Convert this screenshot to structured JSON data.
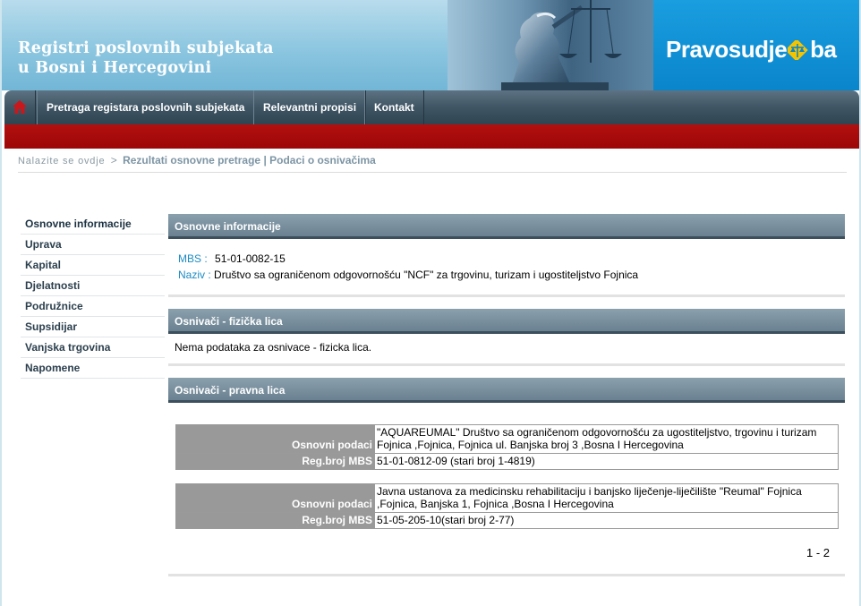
{
  "header": {
    "title_line1": "Registri poslovnih subjekata",
    "title_line2": "u Bosni i Hercegovini",
    "logo_left": "Pravosudje",
    "logo_right": "ba"
  },
  "nav": {
    "items": [
      {
        "label": "Pretraga registara poslovnih subjekata"
      },
      {
        "label": "Relevantni propisi"
      },
      {
        "label": "Kontakt"
      }
    ]
  },
  "breadcrumb": {
    "prefix": "Nalazite se ovdje",
    "separator": ">",
    "current": "Rezultati osnovne pretrage | Podaci o osnivačima"
  },
  "sidebar": {
    "items": [
      {
        "label": "Osnovne informacije"
      },
      {
        "label": "Uprava"
      },
      {
        "label": "Kapital"
      },
      {
        "label": "Djelatnosti"
      },
      {
        "label": "Podružnice"
      },
      {
        "label": "Supsidijar"
      },
      {
        "label": "Vanjska trgovina"
      },
      {
        "label": "Napomene"
      }
    ]
  },
  "basic_info": {
    "heading": "Osnovne informacije",
    "mbs_label": "MBS :",
    "mbs_value": "51-01-0082-15",
    "name_label": "Naziv :",
    "name_value": "Društvo sa ograničenom odgovornošću \"NCF\" za trgovinu, turizam i ugostiteljstvo Fojnica"
  },
  "natural_persons": {
    "heading": "Osnivači - fizička lica",
    "empty_text": "Nema podataka za osnivace - fizicka lica."
  },
  "legal_persons": {
    "heading": "Osnivači - pravna lica",
    "basic_label": "Osnovni podaci",
    "reg_label": "Reg.broj MBS",
    "rows": [
      {
        "basic_line1": "\"AQUAREUMAL\" Društvo sa ograničenom odgovornošću za ugostiteljstvo, trgovinu i turizam",
        "basic_line2": "Fojnica ,Fojnica, Fojnica ul. Banjska broj 3 ,Bosna I Hercegovina",
        "reg": "51-01-0812-09 (stari broj 1-4819)"
      },
      {
        "basic_line1": "Javna ustanova za medicinsku rehabilitaciju i banjsko liječenje-liječilište \"Reumal\" Fojnica",
        "basic_line2": ",Fojnica, Banjska 1, Fojnica ,Bosna I Hercegovina",
        "reg": "51-05-205-10(stari broj 2-77)"
      }
    ],
    "pager": "1 - 2"
  },
  "colors": {
    "nav_dark": "#3f5564",
    "red_bar": "#9c0707",
    "section_head": "#7a909f",
    "label_blue": "#1c8cc4",
    "table_label_bg": "#999999",
    "logo_blue": "#0a85cc"
  }
}
